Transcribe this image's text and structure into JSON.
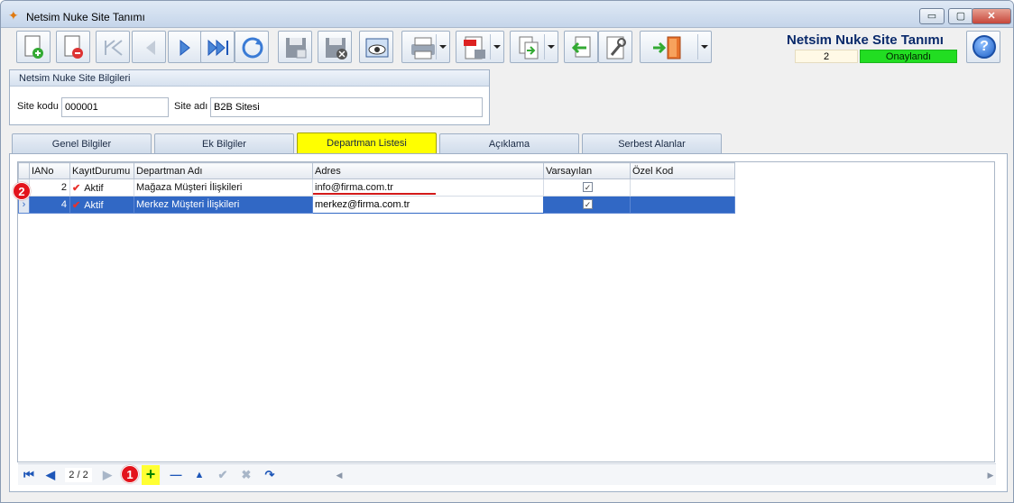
{
  "window": {
    "title": "Netsim Nuke Site Tanımı",
    "controls": {
      "minimize": "▭",
      "maximize": "▢",
      "close": "✕"
    }
  },
  "header": {
    "app_title": "Netsim Nuke Site Tanımı",
    "record_count": "2",
    "status": "Onaylandı",
    "status_color": "#22dd22"
  },
  "site_group": {
    "title": "Netsim Nuke Site Bilgileri",
    "site_kodu_label": "Site kodu",
    "site_kodu_value": "000001",
    "site_adi_label": "Site adı",
    "site_adi_value": "B2B Sitesi"
  },
  "tabs": [
    "Genel Bilgiler",
    "Ek Bilgiler",
    "Departman Listesi",
    "Açıklama",
    "Serbest Alanlar"
  ],
  "active_tab": "Departman Listesi",
  "grid": {
    "columns": [
      "IANo",
      "KayıtDurumu",
      "Departman Adı",
      "Adres",
      "Varsayılan",
      "Özel Kod"
    ],
    "rows": [
      {
        "no": "2",
        "status": "Aktif",
        "name": "Mağaza Müşteri İlişkileri",
        "address": "info@firma.com.tr",
        "default": "✓",
        "code": ""
      },
      {
        "no": "4",
        "status": "Aktif",
        "name": "Merkez Müşteri İlişkileri",
        "address": "merkez@firma.com.tr",
        "default": "✓",
        "code": ""
      }
    ],
    "selected_row": 1
  },
  "navigator": {
    "page": "2 / 2",
    "first": "⏮",
    "prev": "◀",
    "next": "▶",
    "add": "+",
    "remove": "—",
    "up": "▲",
    "confirm": "✔",
    "cancel": "✖",
    "refresh": "↷"
  },
  "annotations": {
    "badge1": "1",
    "badge2": "2"
  }
}
